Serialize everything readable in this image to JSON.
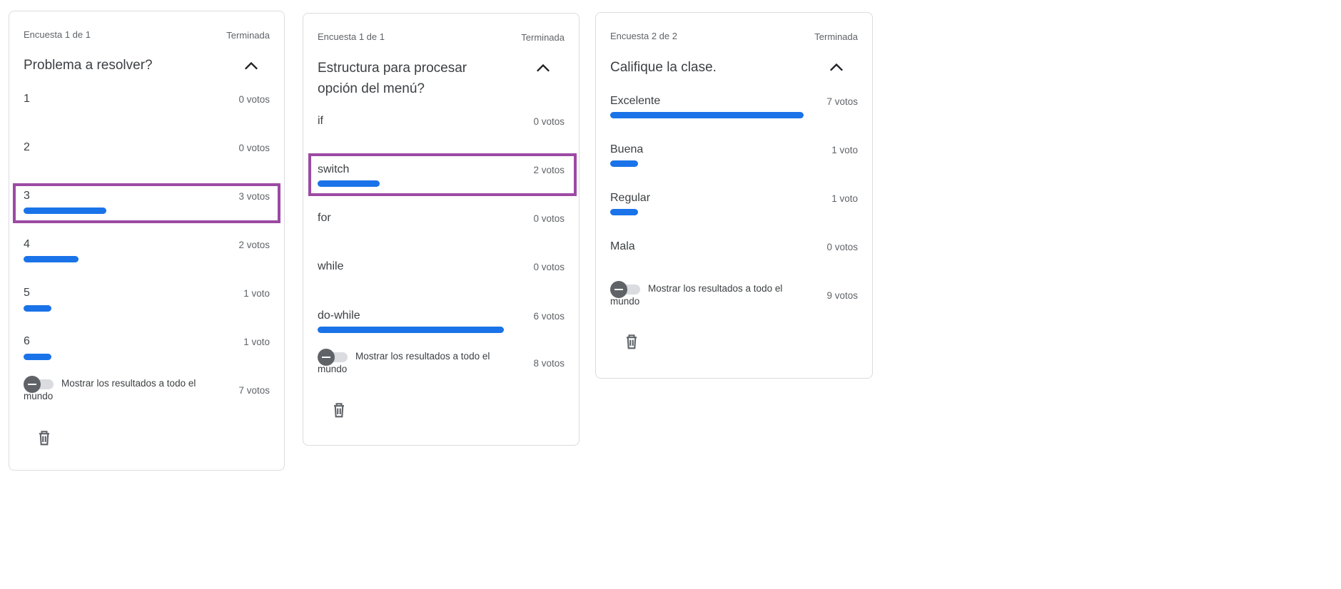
{
  "colors": {
    "bar": "#1a73e8",
    "highlight": "#9c4aa4",
    "border": "#dadce0"
  },
  "icons": {
    "collapse": "chevron-up-icon",
    "delete": "trash-icon",
    "toggle": "toggle-off-icon"
  },
  "polls": [
    {
      "counter": "Encuesta 1 de 1",
      "status": "Terminada",
      "question": "Problema a resolver?",
      "options": [
        {
          "label": "1",
          "votes": "0 votos",
          "share": 0
        },
        {
          "label": "2",
          "votes": "0 votos",
          "share": 0
        },
        {
          "label": "3",
          "votes": "3 votos",
          "share": 0.4286
        },
        {
          "label": "4",
          "votes": "2 votos",
          "share": 0.2857
        },
        {
          "label": "5",
          "votes": "1 voto",
          "share": 0.1429
        },
        {
          "label": "6",
          "votes": "1 voto",
          "share": 0.1429
        }
      ],
      "highlighted_option": "3",
      "share_label": "Mostrar los resultados a todo el mundo",
      "total_votes": "7 votos"
    },
    {
      "counter": "Encuesta 1 de 1",
      "status": "Terminada",
      "question": "Estructura para procesar opción del menú?",
      "options": [
        {
          "label": "if",
          "votes": "0 votos",
          "share": 0
        },
        {
          "label": "switch",
          "votes": "2 votos",
          "share": 0.25
        },
        {
          "label": "for",
          "votes": "0 votos",
          "share": 0
        },
        {
          "label": "while",
          "votes": "0 votos",
          "share": 0
        },
        {
          "label": "do-while",
          "votes": "6 votos",
          "share": 0.75
        }
      ],
      "highlighted_option": "switch",
      "share_label": "Mostrar los resultados a todo el mundo",
      "total_votes": "8 votos"
    },
    {
      "counter": "Encuesta 2 de 2",
      "status": "Terminada",
      "question": "Califique la clase.",
      "options": [
        {
          "label": "Excelente",
          "votes": "7 votos",
          "share": 0.7778
        },
        {
          "label": "Buena",
          "votes": "1 voto",
          "share": 0.1111
        },
        {
          "label": "Regular",
          "votes": "1 voto",
          "share": 0.1111
        },
        {
          "label": "Mala",
          "votes": "0 votos",
          "share": 0
        }
      ],
      "highlighted_option": "",
      "share_label": "Mostrar los resultados a todo el mundo",
      "total_votes": "9 votos"
    }
  ]
}
